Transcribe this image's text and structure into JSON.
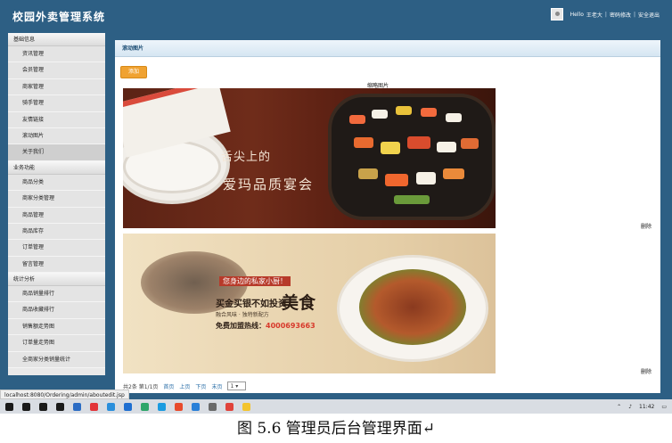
{
  "app": {
    "title": "校园外卖管理系统",
    "greeting": "Hello",
    "user": "王老大",
    "separator": "|",
    "change_password": "密码修改",
    "logout": "安全退出"
  },
  "sidebar": {
    "groups": [
      {
        "label": "基础信息",
        "items": [
          "资讯管理",
          "会员管理",
          "商家管理",
          "骑手管理",
          "友情链接",
          "滚动图片",
          "关于我们"
        ]
      },
      {
        "label": "业务功能",
        "items": [
          "商品分类",
          "商家分类管理",
          "商品管理",
          "商品库存",
          "订单管理",
          "留言管理"
        ]
      },
      {
        "label": "统计分析",
        "items": [
          "商品销量排行",
          "商品收藏排行",
          "销售额走势图",
          "订单量走势图",
          "全商家分类销量统计"
        ]
      }
    ],
    "active_item": "关于我们"
  },
  "main": {
    "panel_title": "滚动图片",
    "add_label": "添加",
    "column_header": "缩略图片",
    "rows": [
      {
        "delete_label": "删除"
      },
      {
        "delete_label": "删除"
      }
    ],
    "banner1": {
      "line1": "舌尖上的",
      "line2": "爱玛品质宴会"
    },
    "banner2": {
      "badge": "您身边的私家小厨！",
      "slogan": "买金买银不如投资",
      "brand": "美食",
      "sub": "融合风味 · 独特新配方",
      "hotline_label": "免费加盟热线：",
      "hotline": "4000693663"
    },
    "pager": {
      "summary": "共2条 第1/1页",
      "first": "首页",
      "prev": "上页",
      "next": "下页",
      "last": "末页",
      "page_value": "1"
    }
  },
  "status_url": "localhost:8080/Ordering/admin/aboutedit.jsp",
  "taskbar": {
    "time": "11:42",
    "icon_colors": [
      "#1a1a1a",
      "#1a1a1a",
      "#1a1a1a",
      "#1a1a1a",
      "#2b6cc4",
      "#e3353a",
      "#2a8fdc",
      "#1f6fd1",
      "#2fa66a",
      "#1b9be0",
      "#e84b2c",
      "#2a80d8",
      "#6a6a6a",
      "#e0433b",
      "#f3c42e"
    ]
  },
  "caption": "图 5.6 管理员后台管理界面↵"
}
